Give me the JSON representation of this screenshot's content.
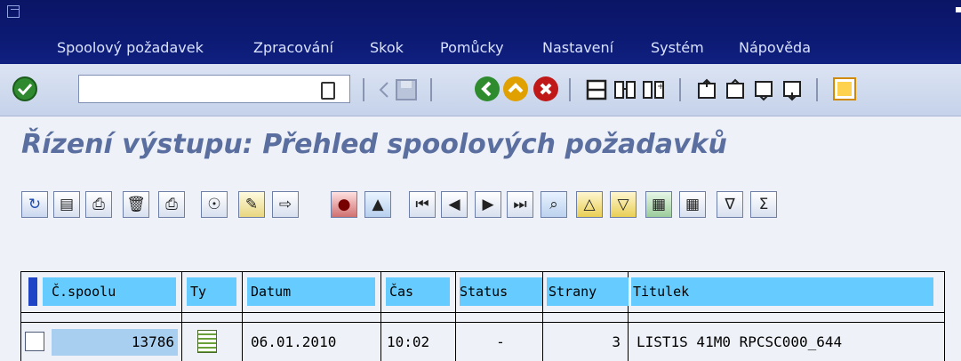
{
  "menu": {
    "items": [
      {
        "label": "Spoolový požadavek"
      },
      {
        "label": "Zpracování"
      },
      {
        "label": "Skok"
      },
      {
        "label": "Pomůcky"
      },
      {
        "label": "Nastavení"
      },
      {
        "label": "Systém"
      },
      {
        "label": "Nápověda"
      }
    ]
  },
  "toolbar": {
    "command_value": ""
  },
  "page": {
    "title": "Řízení výstupu: Přehled spoolových požadavků"
  },
  "table": {
    "headers": {
      "spool": "Č.spoolu",
      "ty": "Ty",
      "datum": "Datum",
      "cas": "Čas",
      "status": "Status",
      "strany": "Strany",
      "titulek": "Titulek"
    },
    "rows": [
      {
        "spool": "13786",
        "datum": "06.01.2010",
        "cas": "10:02",
        "status": "-",
        "strany": "3",
        "titulek": "LIST1S 41M0 RPCSC000_644"
      }
    ]
  },
  "colors": {
    "menubar": "#0c1a73",
    "header_cell": "#66ccff",
    "title": "#5a6f9f"
  }
}
